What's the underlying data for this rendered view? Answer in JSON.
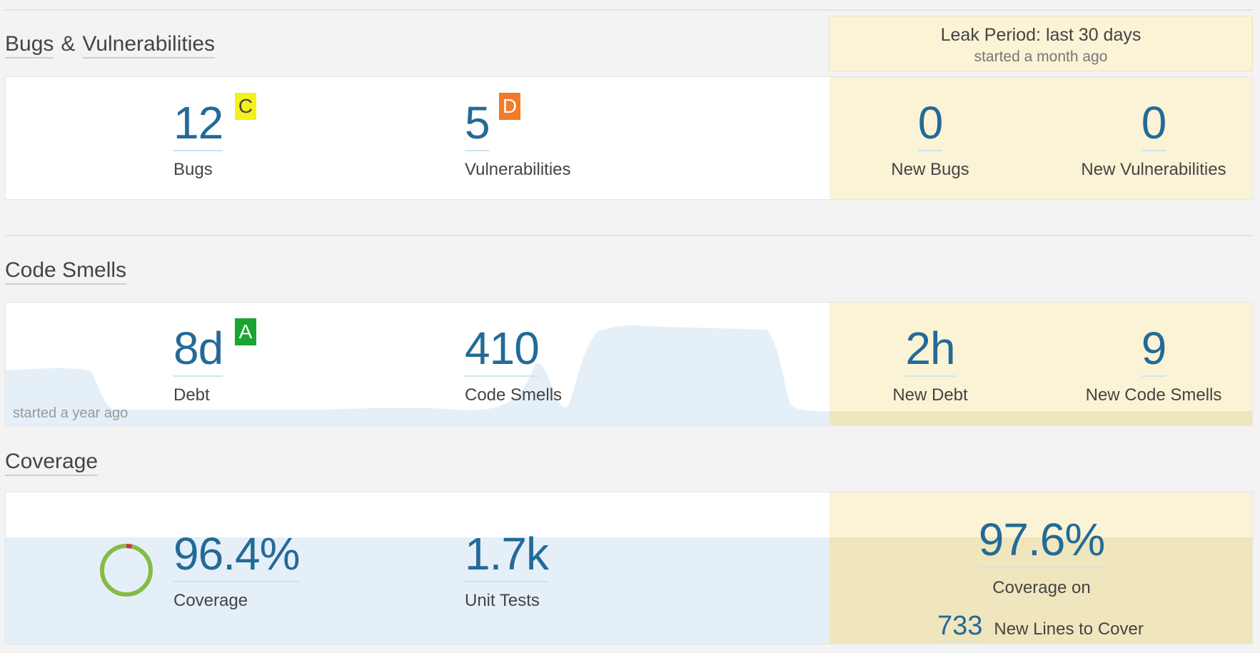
{
  "bugs_section": {
    "title_part1": "Bugs",
    "title_amp": "&",
    "title_part2": "Vulnerabilities",
    "bugs": {
      "value": "12",
      "label": "Bugs",
      "rating": "C"
    },
    "vulnerabilities": {
      "value": "5",
      "label": "Vulnerabilities",
      "rating": "D"
    },
    "new_bugs": {
      "value": "0",
      "label": "New Bugs"
    },
    "new_vulnerabilities": {
      "value": "0",
      "label": "New Vulnerabilities"
    }
  },
  "leak_period": {
    "title": "Leak Period: last 30 days",
    "subtitle": "started a month ago"
  },
  "code_smells_section": {
    "title": "Code Smells",
    "debt": {
      "value": "8d",
      "label": "Debt",
      "rating": "A"
    },
    "code_smells": {
      "value": "410",
      "label": "Code Smells"
    },
    "new_debt": {
      "value": "2h",
      "label": "New Debt"
    },
    "new_code_smells": {
      "value": "9",
      "label": "New Code Smells"
    },
    "history_note": "started a year ago"
  },
  "coverage_section": {
    "title": "Coverage",
    "coverage": {
      "value": "96.4%",
      "label": "Coverage",
      "percent": 96.4
    },
    "unit_tests": {
      "value": "1.7k",
      "label": "Unit Tests"
    },
    "new_coverage": {
      "value": "97.6%",
      "label": "Coverage on",
      "new_lines_value": "733",
      "new_lines_label": "New Lines to Cover"
    }
  },
  "colors": {
    "measure_blue": "#236a97",
    "leak_bg": "#fbf3d5",
    "rating_a": "#19a531",
    "rating_c": "#f4f01e",
    "rating_d": "#f37a26",
    "history_fill": "#e4eff8",
    "donut_green": "#85bb43",
    "donut_red": "#d4333f"
  }
}
